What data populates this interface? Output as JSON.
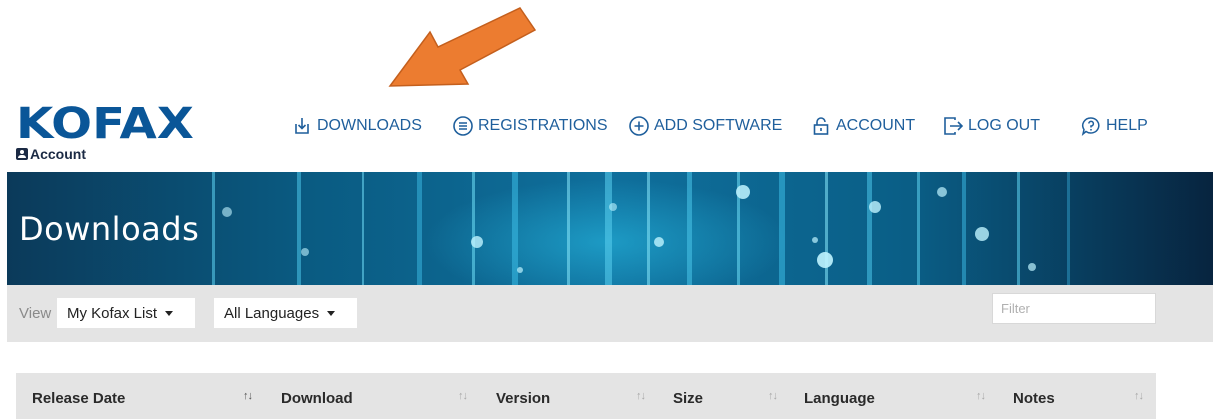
{
  "brand": {
    "logo_text": "KOFAX",
    "sub_label": "Account"
  },
  "nav": {
    "items": [
      {
        "label": "DOWNLOADS",
        "icon": "download-icon"
      },
      {
        "label": "REGISTRATIONS",
        "icon": "list-circle-icon"
      },
      {
        "label": "ADD SOFTWARE",
        "icon": "plus-circle-icon"
      },
      {
        "label": "ACCOUNT",
        "icon": "lock-icon"
      },
      {
        "label": "LOG OUT",
        "icon": "logout-icon"
      },
      {
        "label": "HELP",
        "icon": "help-bubble-icon"
      }
    ]
  },
  "banner": {
    "title": "Downloads"
  },
  "filters": {
    "view_label": "View",
    "view_selected": "My Kofax List",
    "language_selected": "All Languages",
    "filter_placeholder": "Filter"
  },
  "table": {
    "columns": [
      "Release Date",
      "Download",
      "Version",
      "Size",
      "Language",
      "Notes"
    ],
    "sort_glyph": "↑↓"
  },
  "colors": {
    "brand": "#0a5698",
    "nav_text": "#1f5f9c",
    "arrow": "#ec7c30",
    "filterbar_bg": "#e4e4e4"
  },
  "annotation": {
    "icon": "orange-pointer-arrow"
  }
}
